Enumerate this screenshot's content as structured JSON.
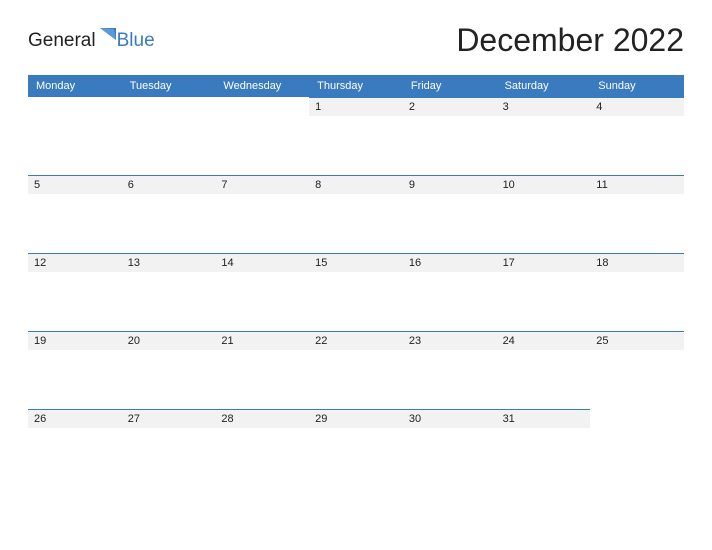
{
  "logo": {
    "text_general": "General",
    "text_blue": "Blue"
  },
  "title": "December 2022",
  "weekdays": [
    "Monday",
    "Tuesday",
    "Wednesday",
    "Thursday",
    "Friday",
    "Saturday",
    "Sunday"
  ],
  "weeks": [
    [
      "",
      "",
      "",
      "1",
      "2",
      "3",
      "4"
    ],
    [
      "5",
      "6",
      "7",
      "8",
      "9",
      "10",
      "11"
    ],
    [
      "12",
      "13",
      "14",
      "15",
      "16",
      "17",
      "18"
    ],
    [
      "19",
      "20",
      "21",
      "22",
      "23",
      "24",
      "25"
    ],
    [
      "26",
      "27",
      "28",
      "29",
      "30",
      "31",
      ""
    ]
  ]
}
